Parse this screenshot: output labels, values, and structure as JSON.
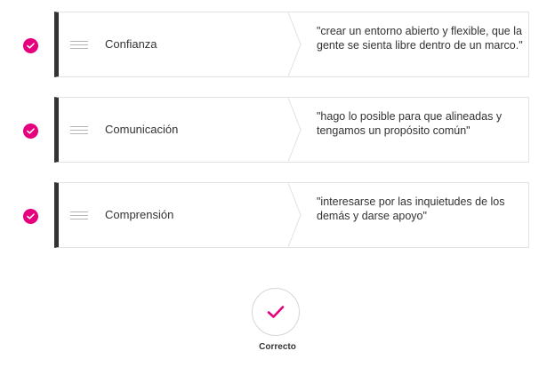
{
  "colors": {
    "accent": "#e6007e",
    "card_border": "#e2e2e2",
    "card_left_bar": "#333333",
    "text": "#333333"
  },
  "rows": [
    {
      "term": "Confianza",
      "quote": "\"crear un entorno abierto y flexible, que la gente se sienta libre dentro de un marco.\"",
      "status_icon": "check-circle-icon"
    },
    {
      "term": "Comunicación",
      "quote": "\"hago lo posible para que alineadas y tengamos un propósito común\"",
      "status_icon": "check-circle-icon"
    },
    {
      "term": "Comprensión",
      "quote": "\"interesarse por las inquietudes de los demás y darse apoyo\"",
      "status_icon": "check-circle-icon"
    }
  ],
  "result": {
    "icon": "check-icon",
    "label": "Correcto"
  }
}
